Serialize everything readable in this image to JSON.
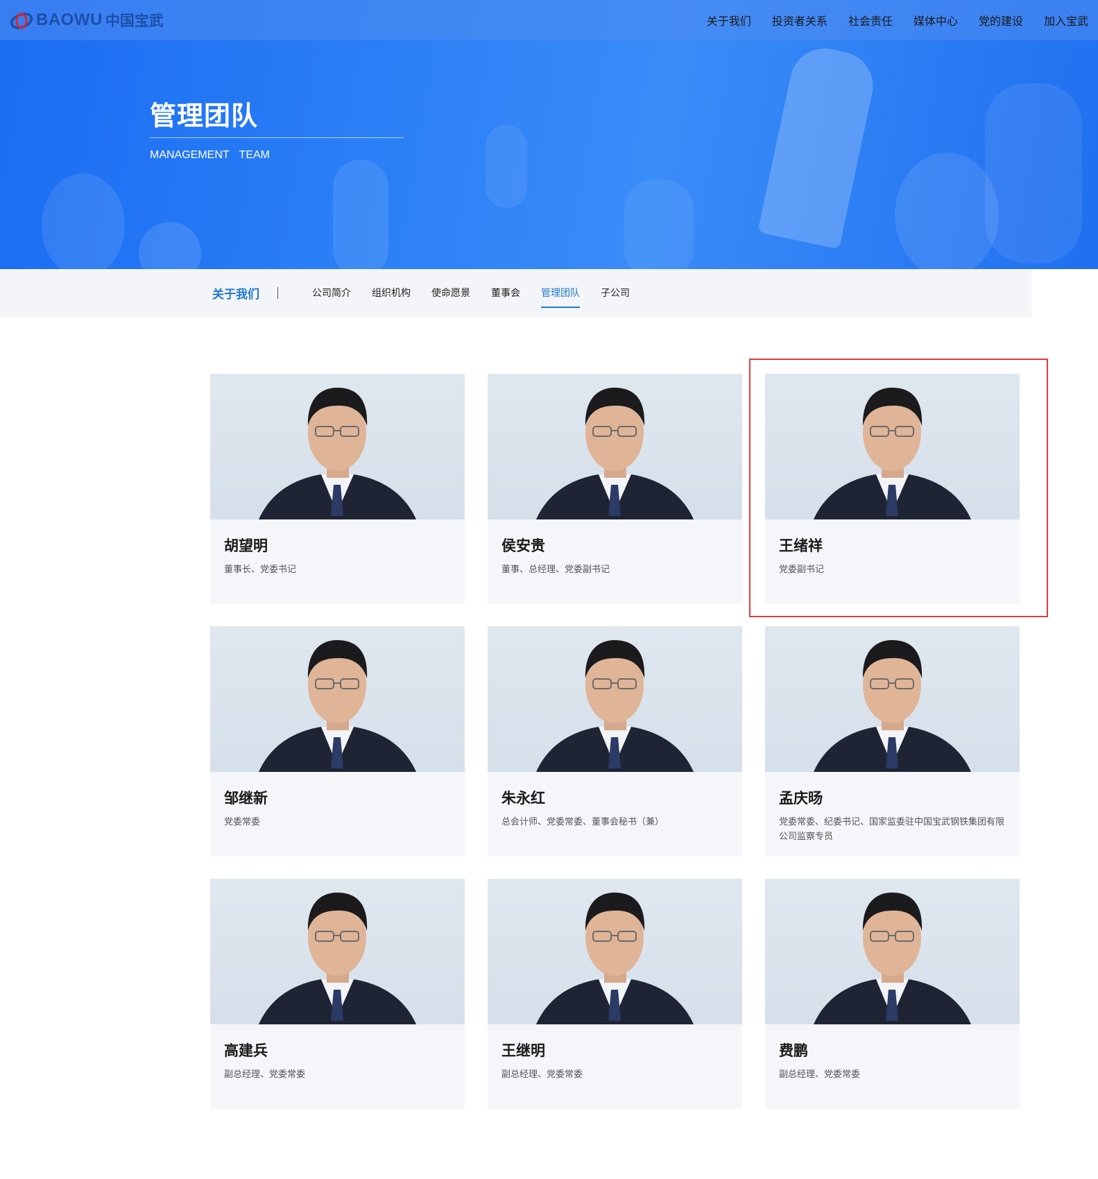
{
  "brand": {
    "logo_en": "BAOWU",
    "logo_cn": "中国宝武"
  },
  "top_nav": [
    "关于我们",
    "投资者关系",
    "社会责任",
    "媒体中心",
    "党的建设",
    "加入宝武"
  ],
  "hero": {
    "title": "管理团队",
    "subtitle": "MANAGEMENT TEAM"
  },
  "sub_nav": {
    "section": "关于我们",
    "items": [
      {
        "label": "公司简介",
        "active": false
      },
      {
        "label": "组织机构",
        "active": false
      },
      {
        "label": "使命愿景",
        "active": false
      },
      {
        "label": "董事会",
        "active": false
      },
      {
        "label": "管理团队",
        "active": true
      },
      {
        "label": "子公司",
        "active": false
      }
    ]
  },
  "members": [
    {
      "name": "胡望明",
      "title": "董事长、党委书记"
    },
    {
      "name": "侯安贵",
      "title": "董事、总经理、党委副书记"
    },
    {
      "name": "王绪祥",
      "title": "党委副书记",
      "highlighted": true
    },
    {
      "name": "邹继新",
      "title": "党委常委"
    },
    {
      "name": "朱永红",
      "title": "总会计师、党委常委、董事会秘书（兼）"
    },
    {
      "name": "孟庆旸",
      "title": "党委常委、纪委书记、国家监委驻中国宝武钢铁集团有限公司监察专员"
    },
    {
      "name": "高建兵",
      "title": "副总经理、党委常委"
    },
    {
      "name": "王继明",
      "title": "副总经理、党委常委"
    },
    {
      "name": "费鹏",
      "title": "副总经理、党委常委"
    }
  ],
  "colors": {
    "accent": "#1f78d1",
    "highlight_border": "#e23b3b",
    "hero_blue": "#2b7ff6"
  }
}
